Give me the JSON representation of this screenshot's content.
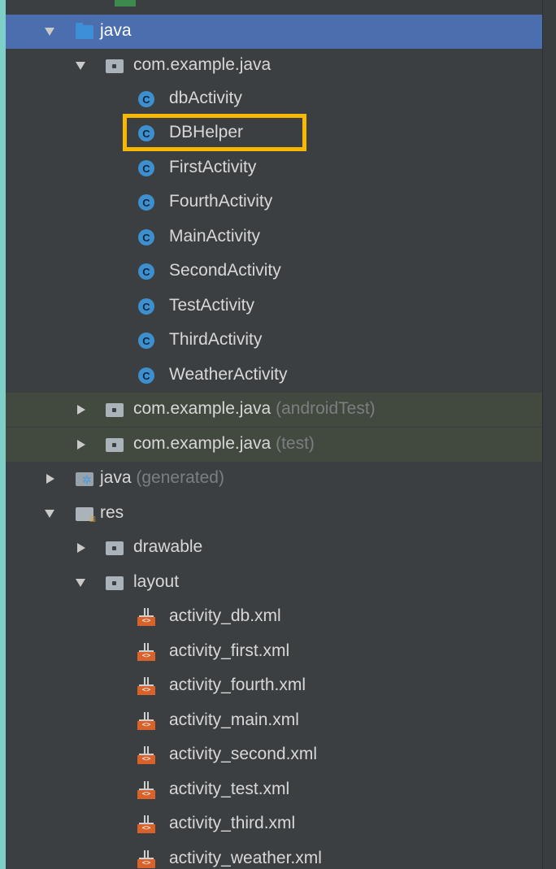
{
  "tree": {
    "java_folder": {
      "label": "java"
    },
    "main_package": {
      "label": "com.example.java",
      "classes": [
        "dbActivity",
        "DBHelper",
        "FirstActivity",
        "FourthActivity",
        "MainActivity",
        "SecondActivity",
        "TestActivity",
        "ThirdActivity",
        "WeatherActivity"
      ]
    },
    "android_test_package": {
      "label": "com.example.java",
      "hint": "(androidTest)"
    },
    "test_package": {
      "label": "com.example.java",
      "hint": "(test)"
    },
    "generated_folder": {
      "label": "java",
      "hint": "(generated)"
    },
    "res_folder": {
      "label": "res"
    },
    "drawable_folder": {
      "label": "drawable"
    },
    "layout_folder": {
      "label": "layout",
      "files": [
        "activity_db.xml",
        "activity_first.xml",
        "activity_fourth.xml",
        "activity_main.xml",
        "activity_second.xml",
        "activity_test.xml",
        "activity_third.xml",
        "activity_weather.xml"
      ]
    }
  },
  "icons": {
    "class_letter": "C",
    "xml_glyph": "<>"
  },
  "colors": {
    "selection": "#4b6eaf",
    "highlight": "#f6b800",
    "class_icon": "#3e8fce",
    "layout_icon": "#d9622a"
  },
  "highlighted_item": "DBHelper"
}
